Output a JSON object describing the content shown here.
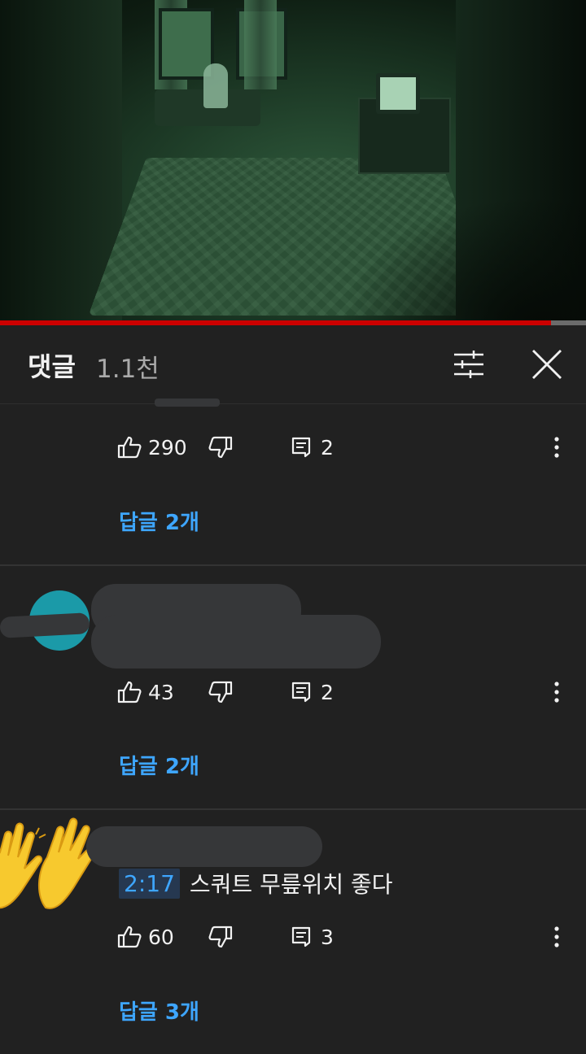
{
  "video": {
    "progress_fraction": 0.94,
    "progress_color": "#cc0000"
  },
  "comments_header": {
    "title": "댓글",
    "count": "1.1천",
    "filter_icon": "sliders-icon",
    "close_icon": "close-icon"
  },
  "comments": [
    {
      "author_hidden": true,
      "text": "",
      "likes": "290",
      "reply_count": "2",
      "replies_link": "답글 2개"
    },
    {
      "author_hidden": true,
      "avatar_color": "#1b9aa8",
      "text": "",
      "likes": "43",
      "reply_count": "2",
      "replies_link": "답글 2개"
    },
    {
      "author_hidden": true,
      "avatar_icon": "raised-hands-emoji",
      "timestamp": "2:17",
      "text": "스쿼트 무릎위치 좋다",
      "likes": "60",
      "reply_count": "3",
      "replies_link": "답글 3개"
    }
  ],
  "colors": {
    "background": "#212121",
    "link": "#3ea6ff",
    "text": "#f1f1f1",
    "muted": "#aaaaaa"
  }
}
